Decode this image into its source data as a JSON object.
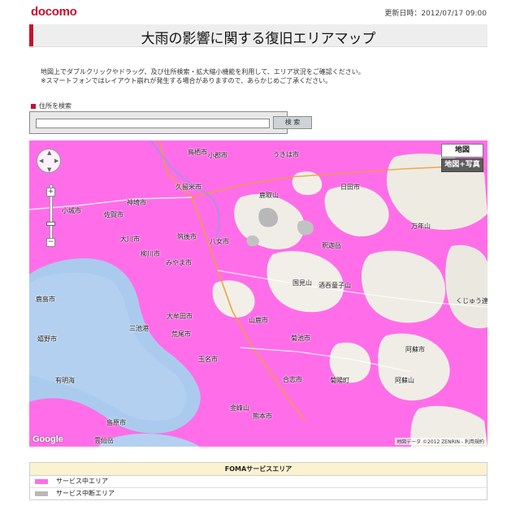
{
  "header": {
    "logo": "docomo",
    "updated": "更新日時：2012/07/17 09:00",
    "title": "大雨の影響に関する復旧エリアマップ"
  },
  "intro": {
    "line1": "地図上でダブルクリックやドラッグ、及び住所検索・拡大縮小機能を利用して、エリア状況をご確認ください。",
    "line2": "※スマートフォンではレイアウト崩れが発生する場合がありますので、あらかじめご了承ください。"
  },
  "search": {
    "label": "住所を検索",
    "value": "",
    "button": "検 索"
  },
  "map": {
    "type_map": "地図",
    "type_satellite": "地図+写真",
    "google": "Google",
    "copyright": "地図データ ©2012 ZENRIN - 利用規約",
    "places": [
      {
        "text": "鳥栖市",
        "x": "195",
        "y": "9"
      },
      {
        "text": "小郡市",
        "x": "220",
        "y": "13"
      },
      {
        "text": "うきは市",
        "x": "300",
        "y": "12"
      },
      {
        "text": "日田市",
        "x": "383",
        "y": "52"
      },
      {
        "text": "久留米市",
        "x": "180",
        "y": "52"
      },
      {
        "text": "鹿取山",
        "x": "283",
        "y": "62"
      },
      {
        "text": "神埼市",
        "x": "120",
        "y": "71"
      },
      {
        "text": "小城市",
        "x": "40",
        "y": "81"
      },
      {
        "text": "佐賀市",
        "x": "92",
        "y": "86"
      },
      {
        "text": "万年山",
        "x": "470",
        "y": "100"
      },
      {
        "text": "大川市",
        "x": "112",
        "y": "116"
      },
      {
        "text": "筑後市",
        "x": "182",
        "y": "113"
      },
      {
        "text": "八女市",
        "x": "222",
        "y": "119"
      },
      {
        "text": "釈迦岳",
        "x": "360",
        "y": "124"
      },
      {
        "text": "柳川市",
        "x": "137",
        "y": "134"
      },
      {
        "text": "みやま市",
        "x": "168",
        "y": "145"
      },
      {
        "text": "国見山",
        "x": "324",
        "y": "170"
      },
      {
        "text": "酒吞童子山",
        "x": "356",
        "y": "173"
      },
      {
        "text": "くじゅう連山",
        "x": "525",
        "y": "192"
      },
      {
        "text": "大牟田市",
        "x": "169",
        "y": "211"
      },
      {
        "text": "山鹿市",
        "x": "270",
        "y": "216"
      },
      {
        "text": "荒尾市",
        "x": "175",
        "y": "233"
      },
      {
        "text": "菊池市",
        "x": "322",
        "y": "238"
      },
      {
        "text": "阿蘇市",
        "x": "463",
        "y": "252"
      },
      {
        "text": "玉名市",
        "x": "208",
        "y": "264"
      },
      {
        "text": "合志市",
        "x": "312",
        "y": "289"
      },
      {
        "text": "阿蘇山",
        "x": "450",
        "y": "290"
      },
      {
        "text": "金峰山",
        "x": "247",
        "y": "324"
      },
      {
        "text": "熊本市",
        "x": "275",
        "y": "334"
      },
      {
        "text": "島原市",
        "x": "95",
        "y": "342"
      },
      {
        "text": "雲仙岳",
        "x": "80",
        "y": "364"
      },
      {
        "text": "鹿島市",
        "x": "8",
        "y": "190"
      },
      {
        "text": "有明海",
        "x": "32",
        "y": "290"
      },
      {
        "text": "嬉野市",
        "x": "10",
        "y": "239"
      },
      {
        "text": "三池港",
        "x": "123",
        "y": "226"
      },
      {
        "text": "菊陽町",
        "x": "370",
        "y": "290"
      }
    ]
  },
  "legend": {
    "title": "FOMAサービスエリア",
    "in_service": "サービス中エリア",
    "suspended": "サービス中断エリア",
    "in_color": "#ff6ee8",
    "suspended_color": "#b8b8b8"
  }
}
